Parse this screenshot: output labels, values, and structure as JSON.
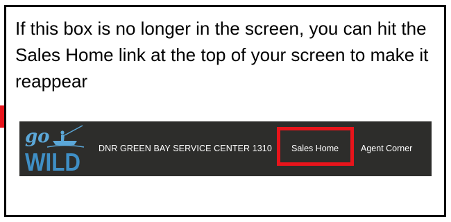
{
  "instruction": {
    "text": "If this box is no longer in the screen, you can hit the Sales Home link at the top of your screen to make it reappear"
  },
  "navbar": {
    "logo": {
      "text_top": "go",
      "text_bottom": "WILD",
      "icon": "boat-fisherman-icon"
    },
    "agency": "DNR GREEN BAY SERVICE CENTER 1310",
    "links": [
      {
        "label": "Sales Home",
        "highlighted": true
      },
      {
        "label": "Agent Corner",
        "highlighted": false
      }
    ]
  },
  "colors": {
    "navbar_bg": "#2d2d2b",
    "highlight": "#e8141b",
    "logo_go": "#5ba7d8",
    "logo_wild": "#3f8fc6"
  }
}
